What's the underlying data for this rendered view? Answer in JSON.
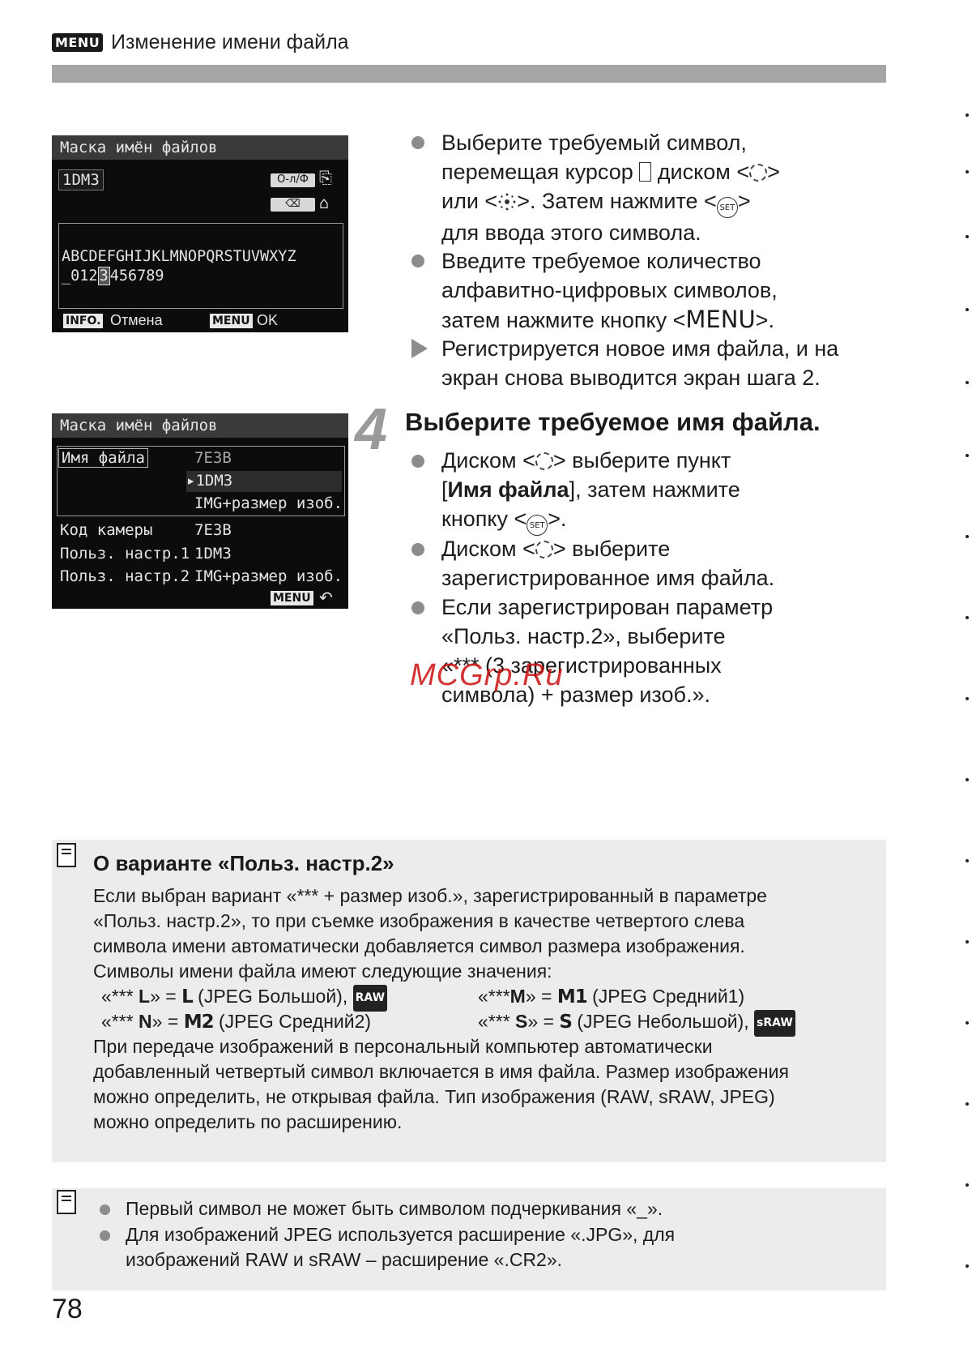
{
  "header": {
    "badge": "MENU",
    "title": "Изменение имени файла"
  },
  "screen1": {
    "title": "Маска имён файлов",
    "input": "1DM3",
    "icon_top": "О-л/Ф",
    "icon_bottom": "⌫",
    "chars_row1": "ABCDEFGHIJKLMNOPQRSTUVWXYZ",
    "chars_row2_pre": "_012",
    "chars_row2_cur": "3",
    "chars_row2_post": "456789",
    "info_badge": "INFO.",
    "cancel": "Отмена",
    "menu_badge": "MENU",
    "ok": "OK"
  },
  "screen2": {
    "title": "Маска имён файлов",
    "file_name_label": "Имя файла",
    "opt1": "7E3B",
    "opt2": "1DM3",
    "opt3": "IMG+размер изоб.",
    "rows": [
      {
        "label": "Код камеры",
        "value": "7E3B"
      },
      {
        "label": "Польз. настр.1",
        "value": "1DM3"
      },
      {
        "label": "Польз. настр.2",
        "value": "IMG+размер изоб."
      }
    ],
    "menu_badge": "MENU",
    "back_symbol": "↶"
  },
  "instructions_top": {
    "b1_l1": "Выберите требуемый символ,",
    "b1_l2a": "перемещая курсор",
    "b1_l2b": "диском <",
    "b1_l2c": ">",
    "b1_l3a": "или <",
    "b1_l3b": ">. Затем нажмите <",
    "b1_l3c": ">",
    "b1_l4": "для ввода этого символа.",
    "b2_l1": "Введите требуемое количество",
    "b2_l2": "алфавитно-цифровых символов,",
    "b2_l3a": "затем нажмите кнопку <",
    "b2_l3b": "MENU",
    "b2_l3c": ">.",
    "r_l1": "Регистрируется новое имя файла, и на",
    "r_l2": "экран снова выводится экран шага 2."
  },
  "step4": {
    "number": "4",
    "heading": "Выберите требуемое имя файла.",
    "b1_l1a": "Диском <",
    "b1_l1b": "> выберите пункт",
    "b1_l2a": "[",
    "b1_l2b": "Имя файла",
    "b1_l2c": "], затем нажмите",
    "b1_l3a": "кнопку <",
    "b1_l3b": ">.",
    "b2_l1a": "Диском <",
    "b2_l1b": "> выберите",
    "b2_l2": "зарегистрированное имя файла.",
    "b3_l1": "Если зарегистрирован параметр",
    "b3_l2": "«Польз. настр.2», выберите",
    "b3_l3": "«*** (3 зарегистрированных",
    "b3_l4": "символа) + размер изоб.»."
  },
  "set_label": "SET",
  "watermark": "MCGrp.Ru",
  "note1": {
    "heading": "О варианте «Польз. настр.2»",
    "p1": "Если выбран вариант «*** + размер изоб.», зарегистрированный в параметре",
    "p2": "«Польз. настр.2», то при съемке изображения в качестве четвертого слева",
    "p3": "символа имени автоматически добавляется символ размера изображения.",
    "p4": "Символы имени файла имеют следующие значения:",
    "l1a": "«*** ",
    "l1b": "L",
    "l1c": "» = ",
    "l1d": "L",
    "l1e": " (JPEG Большой), ",
    "l1raw": "RAW",
    "l2a": "«***",
    "l2b": "M",
    "l2c": "» = ",
    "l2d": "M1",
    "l2e": " (JPEG Средний1)",
    "l3a": "«*** ",
    "l3b": "N",
    "l3c": "» = ",
    "l3d": "M2",
    "l3e": " (JPEG Средний2)",
    "l4a": "«*** ",
    "l4b": "S",
    "l4c": "» = ",
    "l4d": "S",
    "l4e": " (JPEG Небольшой), ",
    "l4raw": "sRAW",
    "q1": "При передаче изображений в персональный компьютер автоматически",
    "q2": "добавленный четвертый символ включается в имя файла. Размер изображения",
    "q3": "можно определить, не открывая файла. Тип изображения (RAW, sRAW, JPEG)",
    "q4": "можно определить по расширению."
  },
  "note2": {
    "b1": "Первый символ не может быть символом подчеркивания «_».",
    "b2_l1": "Для изображений JPEG используется расширение «.JPG», для",
    "b2_l2": "изображений RAW и sRAW – расширение «.CR2»."
  },
  "page_number": "78"
}
